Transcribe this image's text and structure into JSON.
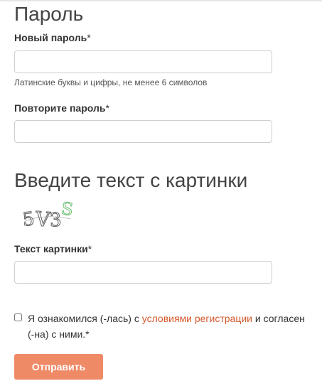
{
  "password_section": {
    "title": "Пароль",
    "new_password": {
      "label": "Новый пароль",
      "required_mark": "*",
      "value": "",
      "hint": "Латинские буквы и цифры, не менее 6 символов"
    },
    "repeat_password": {
      "label": "Повторите пароль",
      "required_mark": "*",
      "value": ""
    }
  },
  "captcha_section": {
    "title": "Введите текст с картинки",
    "image_text": "5V3S",
    "field": {
      "label": "Текст картинки",
      "required_mark": "*",
      "value": ""
    }
  },
  "agreement": {
    "checked": false,
    "text_before": "Я ознакомился (-лась) с ",
    "link_text": "условиями регистрации",
    "text_after": " и согласен (-на) с ними.*",
    "link_color": "#d4582b"
  },
  "submit": {
    "label": "Отправить",
    "color": "#ef8a67"
  }
}
